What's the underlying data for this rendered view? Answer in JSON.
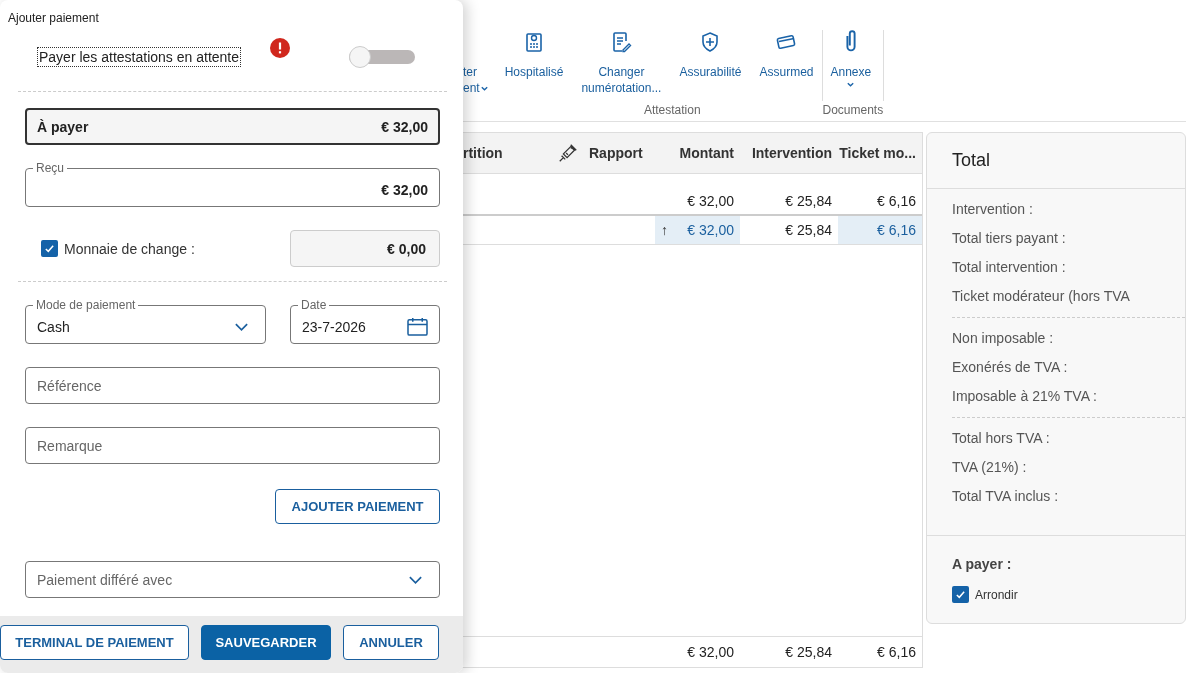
{
  "ribbon": {
    "groups": [
      {
        "label": "Attestation",
        "items": [
          {
            "lines": [
              "ter",
              "ent"
            ],
            "menu": true
          },
          {
            "lines": [
              "Hospitalisé"
            ],
            "menu": false
          },
          {
            "lines": [
              "Changer",
              "numérotation..."
            ],
            "menu": false
          },
          {
            "lines": [
              "Assurabilité"
            ],
            "menu": false
          },
          {
            "lines": [
              "Assurmed"
            ],
            "menu": false
          }
        ]
      },
      {
        "label": "Documents",
        "items": [
          {
            "lines": [
              "Annexe"
            ],
            "menu": true
          }
        ]
      }
    ]
  },
  "table": {
    "columns": [
      "rtition",
      "Rapport",
      "Montant",
      "Intervention",
      "Ticket mo..."
    ],
    "rows": [
      {
        "cells": [
          {
            "text": "",
            "highlighted": false
          },
          {
            "text": "",
            "highlighted": false
          },
          {
            "text": "€ 32,00",
            "highlighted": false
          },
          {
            "text": "€ 25,84",
            "highlighted": false
          },
          {
            "text": "€ 6,16",
            "highlighted": false
          }
        ]
      },
      {
        "cells": [
          {
            "text": "",
            "highlighted": false
          },
          {
            "text": "",
            "highlighted": false
          },
          {
            "text": "€ 32,00",
            "highlighted": true,
            "marker": "↑"
          },
          {
            "text": "€ 25,84",
            "highlighted": false
          },
          {
            "text": "€ 6,16",
            "highlighted": true
          }
        ]
      }
    ],
    "totals": [
      "€ 32,00",
      "€ 25,84",
      "€ 6,16"
    ]
  },
  "total_panel": {
    "title": "Total",
    "sections": [
      [
        "Intervention :",
        "Total tiers payant :",
        "Total intervention :",
        "Ticket modérateur (hors TVA"
      ],
      [
        "Non imposable :",
        "Exonérés de TVA :",
        "Imposable à 21% TVA :"
      ],
      [
        "Total hors TVA :",
        "TVA (21%) :",
        "Total TVA inclus :"
      ]
    ],
    "to_pay_label": "A payer :",
    "round": {
      "label": "Arrondir",
      "checked": true
    }
  },
  "dialog": {
    "title": "Ajouter paiement",
    "pay_pending": {
      "label": "Payer les attestations en attente",
      "error": true,
      "on": false
    },
    "to_pay": {
      "label": "À payer",
      "value": "€ 32,00"
    },
    "received": {
      "label": "Reçu",
      "value": "€ 32,00"
    },
    "change": {
      "label": "Monnaie de change :",
      "checked": true,
      "value": "€ 0,00"
    },
    "payment_mode": {
      "label": "Mode de paiement",
      "value": "Cash"
    },
    "date": {
      "label": "Date",
      "value": "23-7-2026"
    },
    "reference": {
      "placeholder": "Référence"
    },
    "remark": {
      "placeholder": "Remarque"
    },
    "add_button": "AJOUTER PAIEMENT",
    "deferred": {
      "placeholder": "Paiement différé avec"
    },
    "buttons": [
      {
        "label": "TERMINAL DE PAIEMENT",
        "kind": "outline"
      },
      {
        "label": "SAUVEGARDER",
        "kind": "primary"
      },
      {
        "label": "ANNULER",
        "kind": "outline"
      }
    ]
  }
}
